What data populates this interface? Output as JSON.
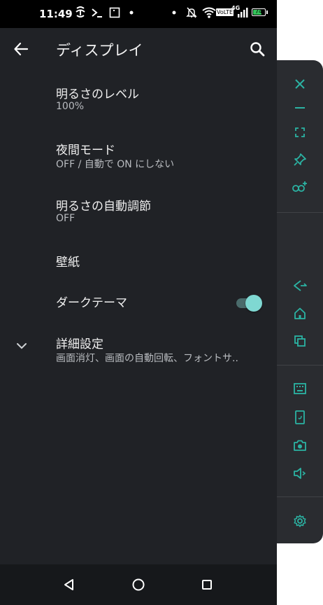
{
  "status_bar": {
    "time": "11:49",
    "network_badge": "VoLTE",
    "network_gen": "4G",
    "battery": "74",
    "battery_level": 0.74
  },
  "app_bar": {
    "title": "ディスプレイ"
  },
  "settings": [
    {
      "title": "明るさのレベル",
      "summary": "100%"
    },
    {
      "title": "夜間モード",
      "summary": "OFF / 自動で ON にしない"
    },
    {
      "title": "明るさの自動調節",
      "summary": "OFF"
    },
    {
      "title": "壁紙",
      "summary": ""
    },
    {
      "title": "ダークテーマ",
      "summary": "",
      "toggle_on": true
    },
    {
      "title": "詳細設定",
      "summary": "画面消灯、画面の自動回転、フォントサ.."
    }
  ],
  "colors": {
    "accent": "#2bb3a3",
    "background": "#202226",
    "panel": "#2a2c30"
  },
  "float_panel_icons": [
    "close-icon",
    "minimize-icon",
    "fullscreen-icon",
    "pin-icon",
    "link-add-icon",
    "back-icon",
    "home-icon",
    "recents-icon",
    "keyboard-icon",
    "rotate-icon",
    "screenshot-icon",
    "volume-icon",
    "settings-icon"
  ]
}
